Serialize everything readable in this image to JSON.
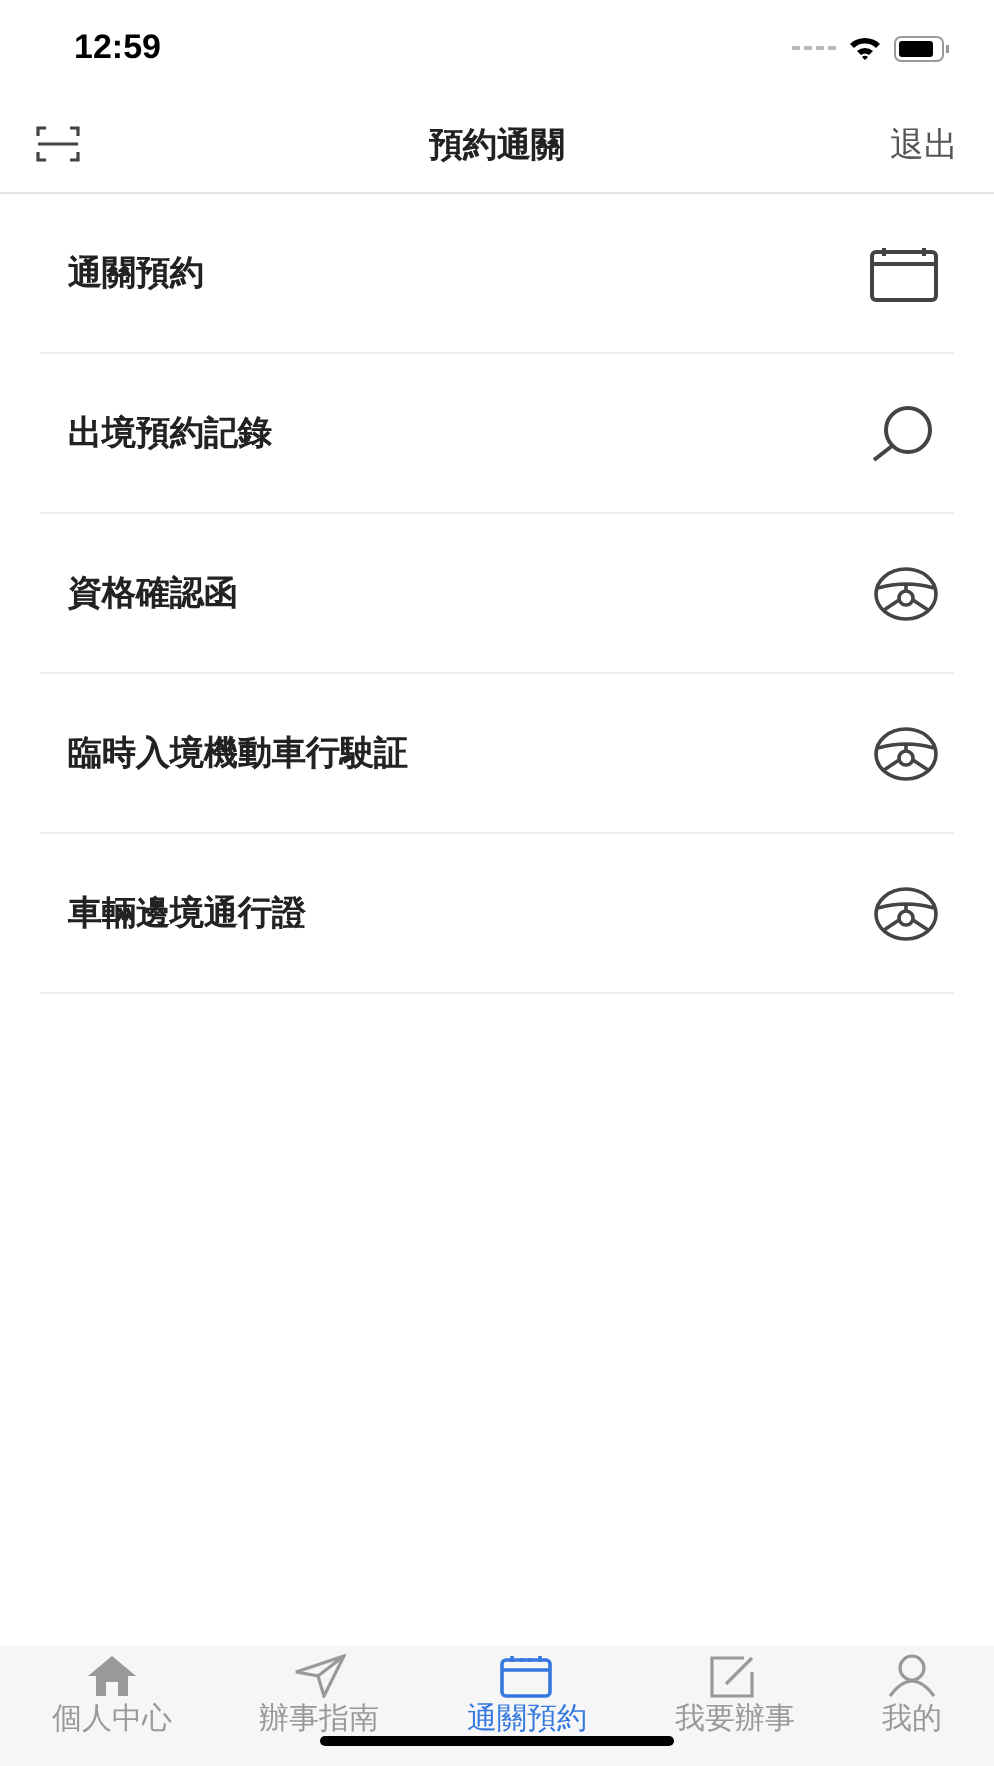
{
  "status_bar": {
    "time": "12:59"
  },
  "nav": {
    "title": "預約通關",
    "action": "退出"
  },
  "items": [
    {
      "label": "通關預約",
      "kind": "calendar"
    },
    {
      "label": "出境預約記錄",
      "kind": "search"
    },
    {
      "label": "資格確認函",
      "kind": "wheel"
    },
    {
      "label": "臨時入境機動車行駛証",
      "kind": "wheel"
    },
    {
      "label": "車輛邊境通行證",
      "kind": "wheel"
    }
  ],
  "tabs": [
    {
      "label": "個人中心",
      "kind": "home",
      "selected": false
    },
    {
      "label": "辦事指南",
      "kind": "send",
      "selected": false
    },
    {
      "label": "通關預約",
      "kind": "calendar",
      "selected": true
    },
    {
      "label": "我要辦事",
      "kind": "edit",
      "selected": false
    },
    {
      "label": "我的",
      "kind": "person",
      "selected": false
    }
  ]
}
